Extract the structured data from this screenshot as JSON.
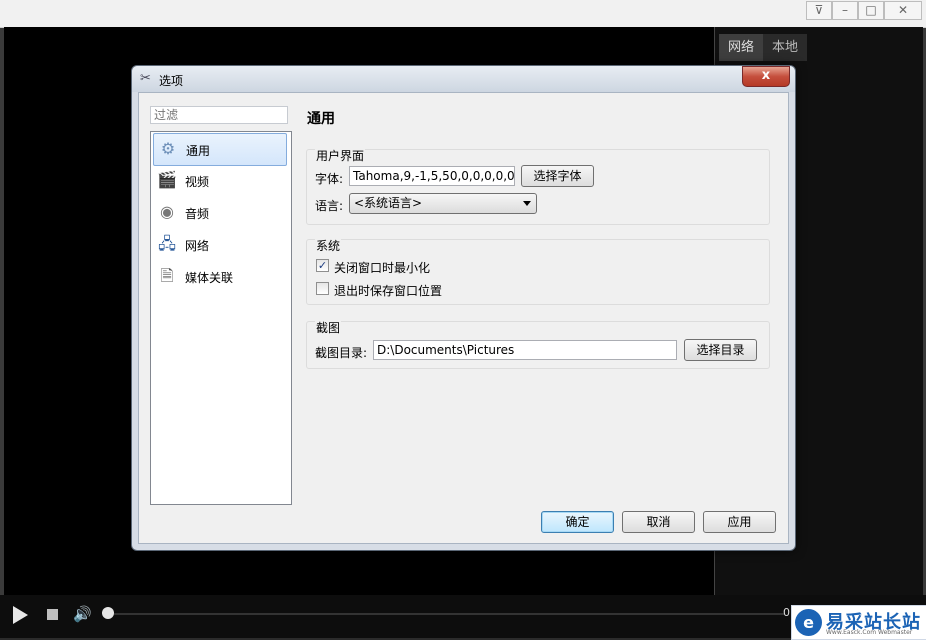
{
  "app": {
    "right_tabs": [
      "网络",
      "本地"
    ],
    "time": "0"
  },
  "watermark": {
    "logo": "e",
    "text": "易采站长站",
    "sub": "Www.Easck.Com Webmaster"
  },
  "dialog": {
    "title": "选项",
    "close_label": "x",
    "filter_placeholder": "过滤",
    "categories": [
      {
        "label": "通用",
        "icon": "gear-icon"
      },
      {
        "label": "视频",
        "icon": "clapperboard-icon"
      },
      {
        "label": "音频",
        "icon": "speaker-icon"
      },
      {
        "label": "网络",
        "icon": "network-icon"
      },
      {
        "label": "媒体关联",
        "icon": "file-association-icon"
      }
    ],
    "page_title": "通用",
    "ui_group": {
      "title": "用户界面",
      "font_label": "字体:",
      "font_value": "Tahoma,9,-1,5,50,0,0,0,0,0",
      "choose_font_button": "选择字体",
      "language_label": "语言:",
      "language_value": "<系统语言>"
    },
    "system_group": {
      "title": "系统",
      "minimize_on_close": {
        "label": "关闭窗口时最小化",
        "checked": true
      },
      "save_position_on_exit": {
        "label": "退出时保存窗口位置",
        "checked": false
      }
    },
    "screenshot_group": {
      "title": "截图",
      "dir_label": "截图目录:",
      "dir_value": "D:\\Documents\\Pictures",
      "choose_dir_button": "选择目录"
    },
    "buttons": {
      "ok": "确定",
      "cancel": "取消",
      "apply": "应用"
    }
  }
}
